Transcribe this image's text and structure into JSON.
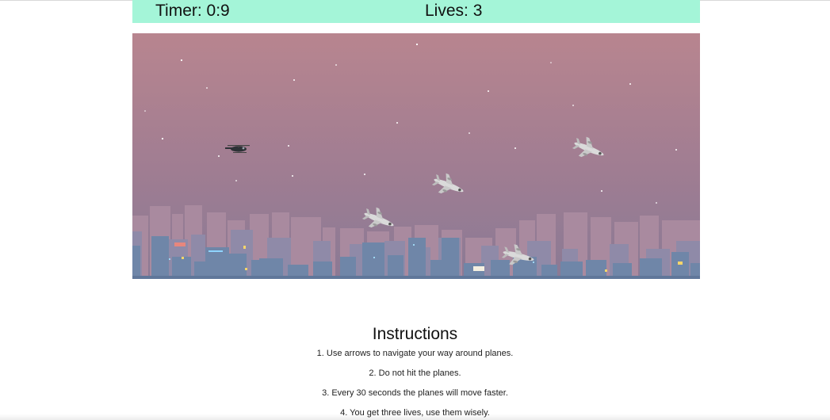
{
  "hud": {
    "timer_text": "Timer: 0:9",
    "lives_text": "Lives: 3",
    "background": "#a4f5d8"
  },
  "game": {
    "sky_top": "#b8858f",
    "sky_bottom": "#8a7a95",
    "player": {
      "sprite": "helicopter-icon"
    },
    "enemies": {
      "sprite": "plane-icon",
      "count": 4
    }
  },
  "instructions": {
    "title": "Instructions",
    "steps": [
      "1. Use arrows to navigate your way around planes.",
      "2. Do not hit the planes.",
      "3. Every 30 seconds the planes will move faster.",
      "4. You get three lives, use them wisely."
    ]
  }
}
